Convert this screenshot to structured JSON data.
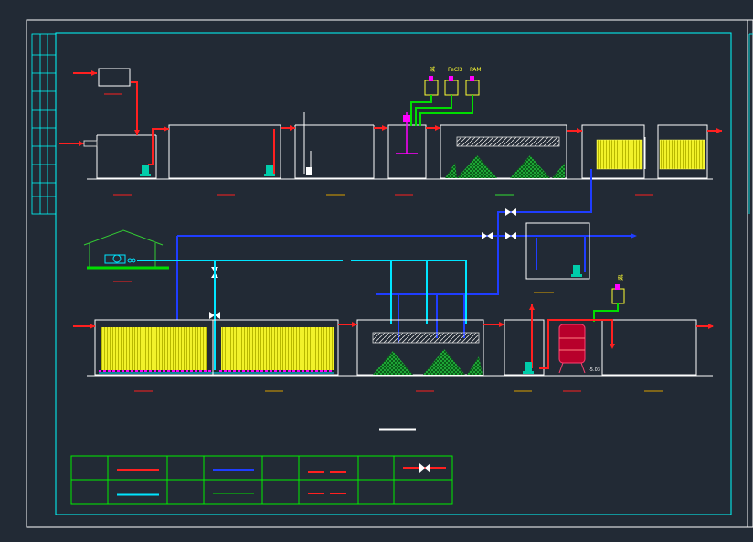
{
  "drawing": {
    "dosing_labels": [
      "碱",
      "FeCl3",
      "PAM"
    ],
    "dosing_label_2": "碱",
    "pump_code": "-5.03"
  },
  "colors": {
    "background": "#222a35",
    "frame": "#ffffff",
    "border": "#00ffff",
    "wastewater": "#ff2020",
    "sludge": "#1f3dff",
    "air": "#00e5ff",
    "chemical": "#00dd00",
    "media": "#ffff33",
    "sludge_fill": "#22cc44",
    "marker": "#ff00ff"
  }
}
